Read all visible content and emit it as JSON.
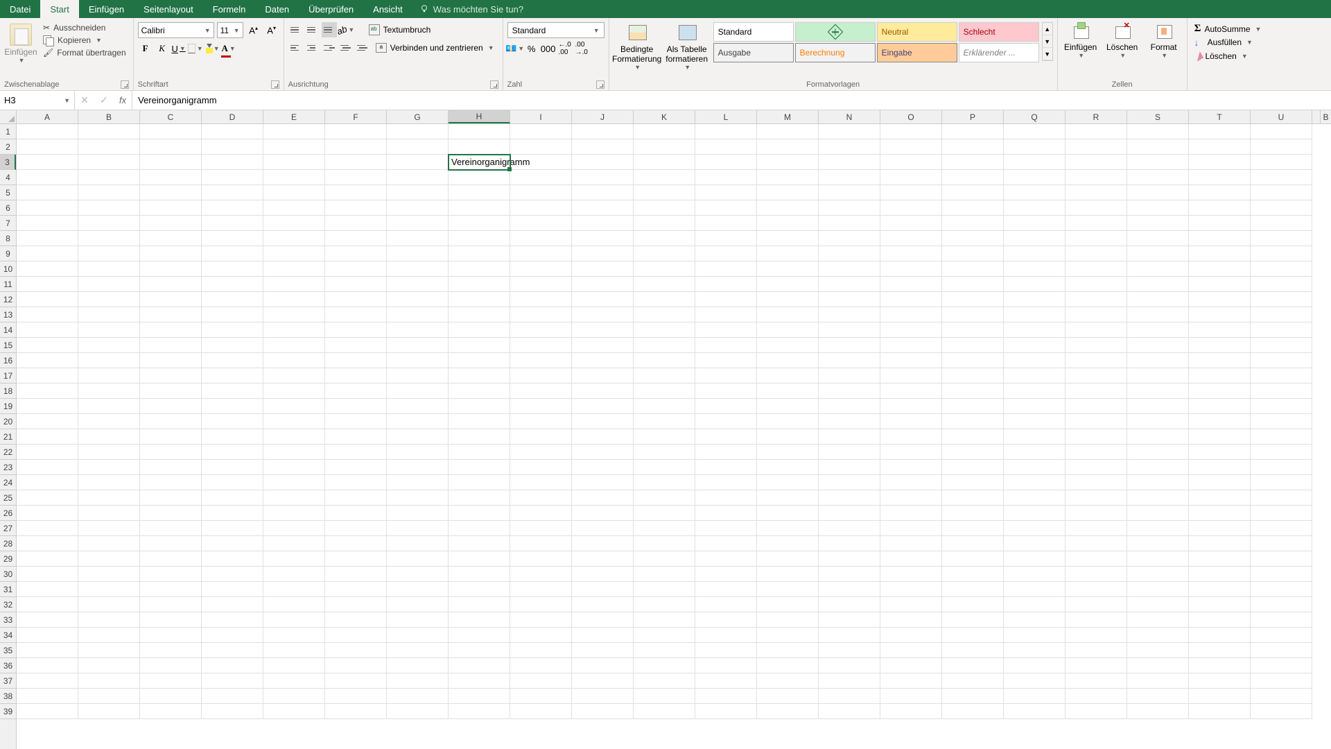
{
  "tabs": {
    "file": "Datei",
    "home": "Start",
    "insert": "Einfügen",
    "page_layout": "Seitenlayout",
    "formulas": "Formeln",
    "data": "Daten",
    "review": "Überprüfen",
    "view": "Ansicht"
  },
  "tell_me": "Was möchten Sie tun?",
  "clipboard": {
    "paste": "Einfügen",
    "cut": "Ausschneiden",
    "copy": "Kopieren",
    "format_painter": "Format übertragen",
    "group_label": "Zwischenablage"
  },
  "font": {
    "name": "Calibri",
    "size": "11",
    "group_label": "Schriftart"
  },
  "alignment": {
    "wrap": "Textumbruch",
    "merge": "Verbinden und zentrieren",
    "group_label": "Ausrichtung"
  },
  "number": {
    "format": "Standard",
    "group_label": "Zahl"
  },
  "styles": {
    "cond_fmt": "Bedingte Formatierung",
    "as_table": "Als Tabelle formatieren",
    "standard": "Standard",
    "neutral": "Neutral",
    "schlecht": "Schlecht",
    "ausgabe": "Ausgabe",
    "berechnung": "Berechnung",
    "eingabe": "Eingabe",
    "erklaerender": "Erklärender ...",
    "group_label": "Formatvorlagen"
  },
  "cells": {
    "insert": "Einfügen",
    "delete": "Löschen",
    "format": "Format",
    "group_label": "Zellen"
  },
  "editing": {
    "autosum": "AutoSumme",
    "fill": "Ausfüllen",
    "clear": "Löschen"
  },
  "name_box": "H3",
  "formula": "Vereinorganigramm",
  "active_cell": {
    "col": "H",
    "row": 3,
    "value": "Vereinorganigramm"
  },
  "columns": [
    "A",
    "B",
    "C",
    "D",
    "E",
    "F",
    "G",
    "H",
    "I",
    "J",
    "K",
    "L",
    "M",
    "N",
    "O",
    "P",
    "Q",
    "R",
    "S",
    "T",
    "U"
  ],
  "last_col_partial": "B",
  "rows": 39
}
